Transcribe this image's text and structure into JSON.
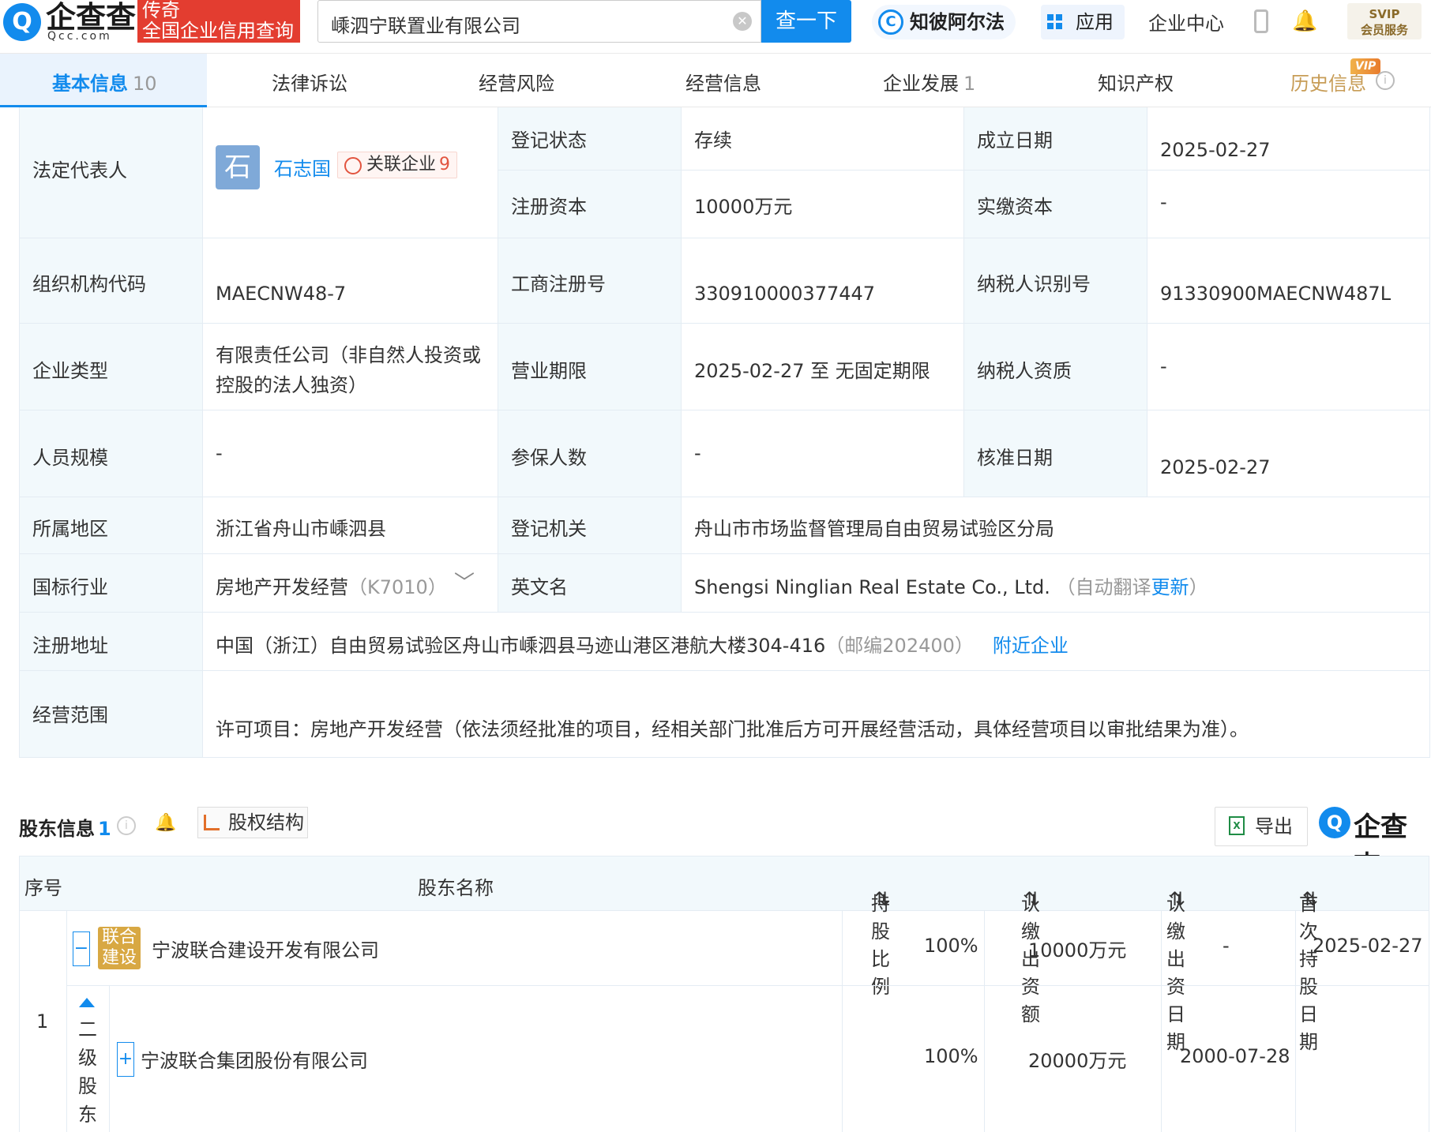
{
  "header": {
    "logo_text": "企查查",
    "logo_sub": "Qcc.com",
    "slogan_line1": "传奇",
    "slogan_line2": "全国企业信用查询",
    "search_value": "嵊泗宁联置业有限公司",
    "search_button": "查一下",
    "zbaef": "知彼阿尔法",
    "apps": "应用",
    "enterprise_center": "企业中心",
    "svip_line1": "SVIP",
    "svip_line2": "会员服务"
  },
  "tabs": [
    {
      "label": "基本信息",
      "count": "10"
    },
    {
      "label": "法律诉讼",
      "count": ""
    },
    {
      "label": "经营风险",
      "count": ""
    },
    {
      "label": "经营信息",
      "count": ""
    },
    {
      "label": "企业发展",
      "count": "1"
    },
    {
      "label": "知识产权",
      "count": ""
    },
    {
      "label": "历史信息",
      "count": "",
      "badge": "VIP"
    }
  ],
  "info": {
    "legal_rep_label": "法定代表人",
    "legal_rep_avatar": "石",
    "legal_rep_name": "石志国",
    "related_label": "关联企业",
    "related_count": "9",
    "reg_status_label": "登记状态",
    "reg_status": "存续",
    "found_date_label": "成立日期",
    "found_date": "2025-02-27",
    "reg_capital_label": "注册资本",
    "reg_capital": "10000万元",
    "paid_capital_label": "实缴资本",
    "paid_capital": "-",
    "org_code_label": "组织机构代码",
    "org_code": "MAECNW48-7",
    "biz_reg_label": "工商注册号",
    "biz_reg": "330910000377447",
    "tax_id_label": "纳税人识别号",
    "tax_id": "91330900MAECNW487L",
    "ent_type_label": "企业类型",
    "ent_type_line1": "有限责任公司（非自然人投资或",
    "ent_type_line2": "控股的法人独资）",
    "term_label": "营业期限",
    "term": "2025-02-27 至 无固定期限",
    "tax_qual_label": "纳税人资质",
    "tax_qual": "-",
    "staff_label": "人员规模",
    "staff": "-",
    "insured_label": "参保人数",
    "insured": "-",
    "approve_label": "核准日期",
    "approve_date": "2025-02-27",
    "region_label": "所属地区",
    "region": "浙江省舟山市嵊泗县",
    "authority_label": "登记机关",
    "authority": "舟山市市场监督管理局自由贸易试验区分局",
    "industry_label": "国标行业",
    "industry": "房地产开发经营",
    "industry_code": "（K7010）",
    "english_label": "英文名",
    "english_name": "Shengsi Ninglian Real Estate Co., Ltd.",
    "english_note_pre": "（自动翻译",
    "english_note_link": "更新",
    "english_note_post": "）",
    "address_label": "注册地址",
    "address": "中国（浙江）自由贸易试验区舟山市嵊泗县马迹山港区港航大楼304-416",
    "postcode": "（邮编202400）",
    "nearby": "附近企业",
    "scope_label": "经营范围",
    "scope": "许可项目：房地产开发经营（依法须经批准的项目，经相关部门批准后方可开展经营活动，具体经营项目以审批结果为准）。"
  },
  "shareholders": {
    "title": "股东信息",
    "count": "1",
    "equity_button": "股权结构",
    "export_button": "导出",
    "watermark": "企查查",
    "columns": [
      "序号",
      "股东名称",
      "持股比例",
      "认缴出资额",
      "认缴出资日期",
      "首次持股日期"
    ],
    "rows": [
      {
        "index": "1",
        "logo_line1": "联合",
        "logo_line2": "建设",
        "name": "宁波联合建设开发有限公司",
        "ratio": "100%",
        "amount": "10000万元",
        "sub_date": "-",
        "first_date": "2025-02-27",
        "sub_label": "二级股东",
        "sub_name": "宁波联合集团股份有限公司",
        "sub_ratio": "100%",
        "sub_amount": "20000万元",
        "sub_sub_date": "2000-07-28",
        "sub_first_date": ""
      }
    ]
  }
}
